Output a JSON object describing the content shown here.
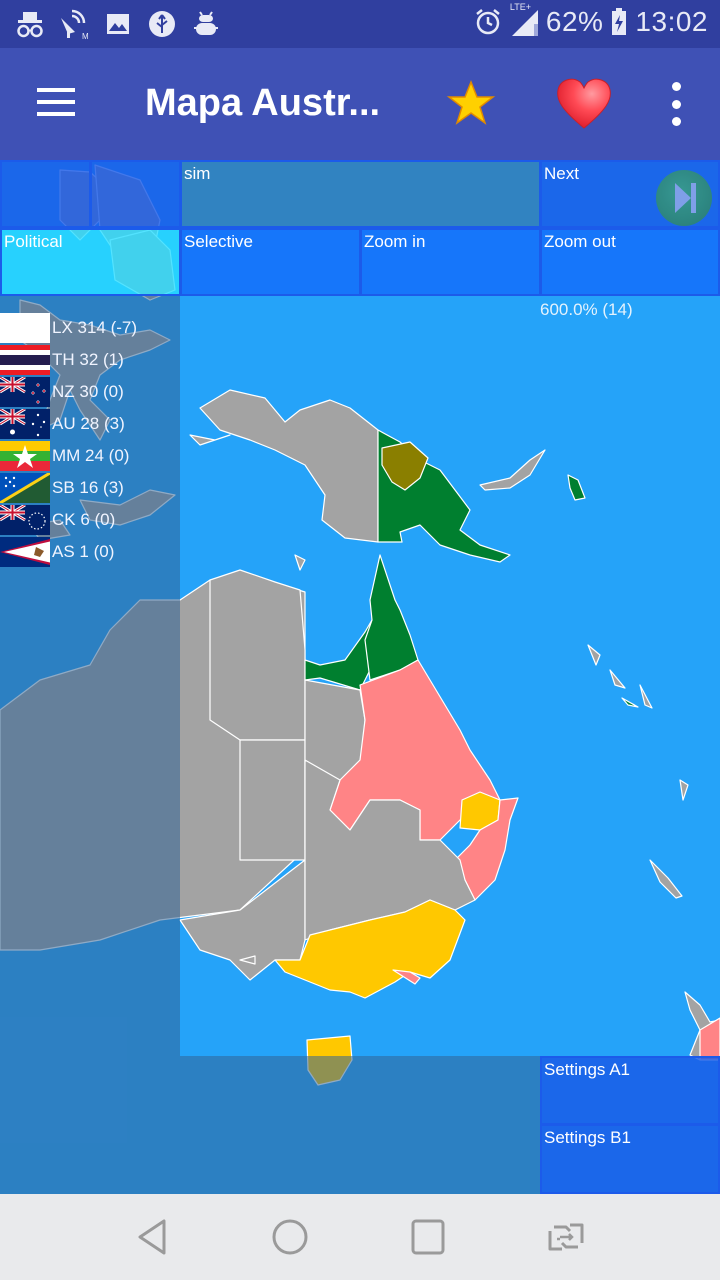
{
  "status_bar": {
    "left_icons": [
      "incognito-icon",
      "satellite-dish-icon",
      "image-icon",
      "usb-icon",
      "android-debug-icon"
    ],
    "right_icons": [
      "alarm-icon",
      "lte-signal-icon",
      "battery-charging-icon"
    ],
    "network_label": "LTE+",
    "battery": "62%",
    "time": "13:02"
  },
  "app_bar": {
    "title": "Mapa Austr...",
    "menu_icon": "hamburger-menu-icon",
    "actions": [
      "star-icon",
      "heart-icon",
      "more-vert-icon"
    ]
  },
  "controls": {
    "sim": "sim",
    "next": "Next",
    "political": "Political",
    "selective": "Selective",
    "zoom_in": "Zoom in",
    "zoom_out": "Zoom out",
    "settings_a1": "Settings A1",
    "settings_b1": "Settings B1"
  },
  "zoom_readout": "600.0% (14)",
  "scoreboard": [
    {
      "code": "LX",
      "label": "LX 314 (-7)",
      "flag": "white-flag"
    },
    {
      "code": "TH",
      "label": "TH 32 (1)",
      "flag": "thailand-flag"
    },
    {
      "code": "NZ",
      "label": "NZ 30 (0)",
      "flag": "new-zealand-flag"
    },
    {
      "code": "AU",
      "label": "AU 28 (3)",
      "flag": "australia-flag"
    },
    {
      "code": "MM",
      "label": "MM 24 (0)",
      "flag": "myanmar-flag"
    },
    {
      "code": "SB",
      "label": "SB 16 (3)",
      "flag": "solomon-islands-flag"
    },
    {
      "code": "CK",
      "label": "CK 6 (0)",
      "flag": "cook-islands-flag"
    },
    {
      "code": "AS",
      "label": "AS 1 (0)",
      "flag": "american-samoa-flag"
    }
  ],
  "map": {
    "colors": {
      "ocean": "#25A3F9",
      "neutral": "#A3A3A3",
      "green": "#007F2F",
      "olive": "#8A7F00",
      "pink": "#FF8486",
      "yellow": "#FFC800"
    }
  },
  "nav_bar": {
    "buttons": [
      "back-icon",
      "home-icon",
      "recents-icon",
      "switch-app-icon"
    ]
  }
}
